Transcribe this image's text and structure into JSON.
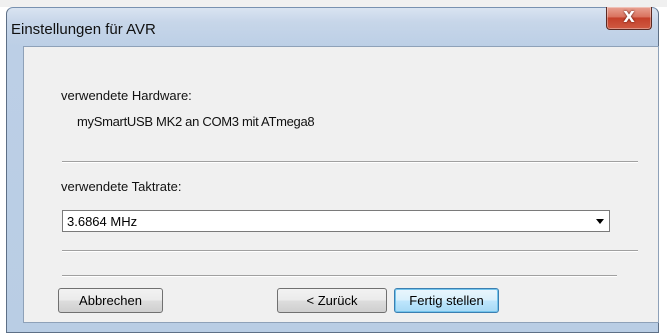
{
  "window": {
    "title": "Einstellungen für AVR",
    "close_glyph": "X"
  },
  "hardware": {
    "label": "verwendete Hardware:",
    "value": "mySmartUSB MK2 an COM3 mit ATmega8"
  },
  "clock": {
    "label": "verwendete Taktrate:",
    "selected": "3.6864 MHz"
  },
  "buttons": {
    "cancel": "Abbrechen",
    "back": "< Zurück",
    "finish": "Fertig stellen"
  }
}
